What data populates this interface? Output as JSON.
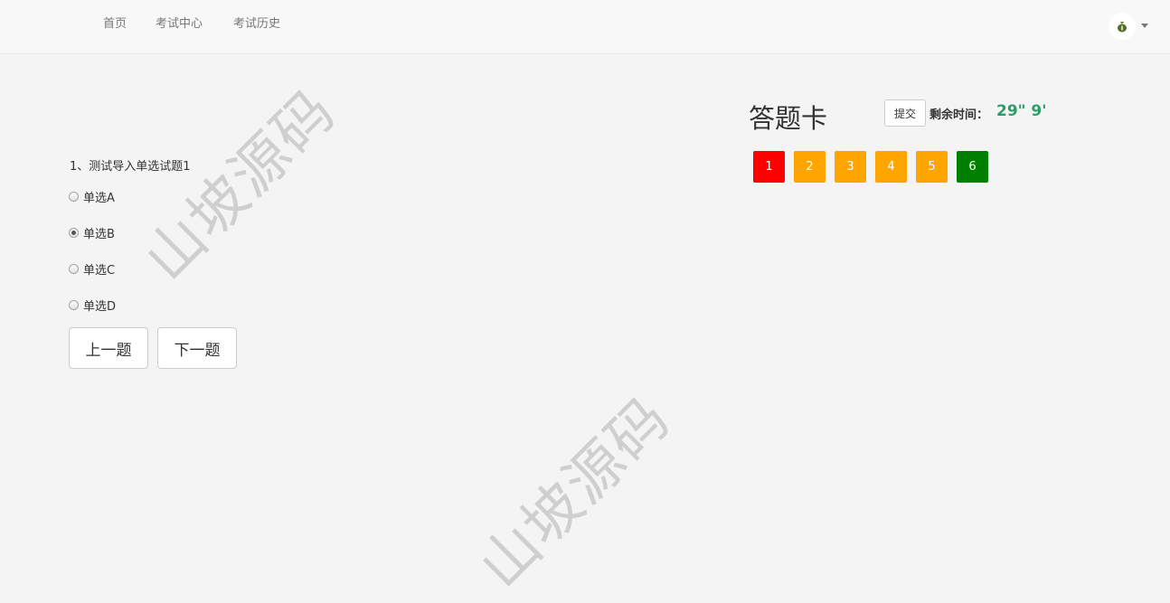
{
  "nav": {
    "items": [
      "首页",
      "考试中心",
      "考试历史"
    ]
  },
  "watermark": {
    "text": "山坡源码"
  },
  "question": {
    "title": "1、测试导入单选试题1",
    "options": [
      {
        "label": "单选A",
        "selected": false
      },
      {
        "label": "单选B",
        "selected": true
      },
      {
        "label": "单选C",
        "selected": false
      },
      {
        "label": "单选D",
        "selected": false
      }
    ]
  },
  "buttons": {
    "prev_label": "上一题",
    "next_label": "下一题"
  },
  "answer_card": {
    "title": "答题卡",
    "submit_label": "提交",
    "time_label": "剩余时间：",
    "time_value": "29\" 9'",
    "numbers": [
      {
        "label": "1",
        "status": "current",
        "color": "#ff0000"
      },
      {
        "label": "2",
        "status": "unanswered",
        "color": "#ffa500"
      },
      {
        "label": "3",
        "status": "unanswered",
        "color": "#ffa500"
      },
      {
        "label": "4",
        "status": "unanswered",
        "color": "#ffa500"
      },
      {
        "label": "5",
        "status": "unanswered",
        "color": "#ffa500"
      },
      {
        "label": "6",
        "status": "answered",
        "color": "#008000"
      }
    ]
  },
  "colors": {
    "time_value": "#2a9d6a",
    "current": "#ff0000",
    "unanswered": "#ffa500",
    "answered": "#008000"
  },
  "icons": {
    "avatar": "user-avatar-icon",
    "dropdown": "caret-down-icon"
  }
}
